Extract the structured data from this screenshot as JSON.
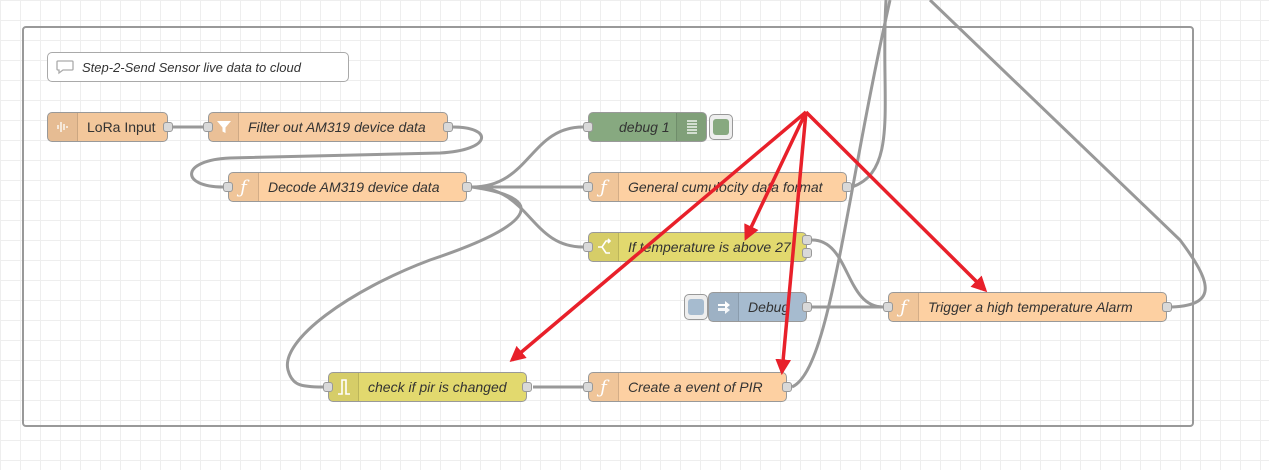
{
  "flow": {
    "comment": "Step-2-Send Sensor live data to cloud",
    "nodes": {
      "lora_input": "LoRa Input",
      "filter": "Filter out AM319 device data",
      "decode": "Decode AM319 device data",
      "debug1": "debug 1",
      "general": "General cumulocity data format",
      "switch": "If temperature is above 27",
      "debug": "Debug",
      "trigger": "Trigger a high temperature Alarm",
      "rbe": "check if pir is changed",
      "event": "Create a event of PIR"
    }
  },
  "colors": {
    "wire": "#999999",
    "annotation_arrow": "#e8202a",
    "group_border": "#999999"
  },
  "icons": {
    "comment": "speech-bubble-icon",
    "lora": "waveform-icon",
    "filter": "funnel-icon",
    "function": "function-icon",
    "debug_list": "list-icon",
    "switch": "switch-icon",
    "link": "link-arrows-icon",
    "rbe": "rbe-icon"
  }
}
